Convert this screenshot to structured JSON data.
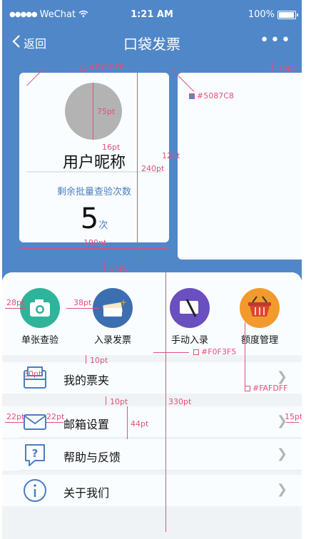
{
  "status": {
    "carrier": "WeChat",
    "time": "1:21 AM",
    "battery": "100%"
  },
  "nav": {
    "back_label": "返回",
    "title": "口袋发票",
    "more": "•••"
  },
  "card": {
    "nickname": "用户昵称",
    "remaining_label": "剩余批量查验次数",
    "remaining_count": "5",
    "unit": "次"
  },
  "quick_actions": [
    {
      "label": "单张查验",
      "icon": "camera-icon",
      "color": "#2FB39A"
    },
    {
      "label": "入录发票",
      "icon": "invoice-entry-icon",
      "color": "#3B6FB0"
    },
    {
      "label": "手动入录",
      "icon": "manual-entry-icon",
      "color": "#6A4FC0"
    },
    {
      "label": "额度管理",
      "icon": "basket-icon",
      "color": "#F29A2E"
    }
  ],
  "menu": [
    {
      "label": "我的票夹",
      "icon": "folder-icon"
    },
    {
      "label": "邮箱设置",
      "icon": "mail-icon"
    },
    {
      "label": "帮助与反馈",
      "icon": "help-icon"
    },
    {
      "label": "关于我们",
      "icon": "info-icon"
    }
  ],
  "annotations": {
    "card_bg": "#FAFDFF",
    "nav_bg": "#5087C8",
    "panel_bg": "#F0F3F5",
    "row_bg": "#FAFDFF",
    "m15": "15pt",
    "m75": "75pt",
    "m16": "16pt",
    "m12": "12pt",
    "m240": "240pt",
    "m190": "190pt",
    "m14": "14pt",
    "m28": "28pt",
    "m38": "38pt",
    "m10a": "10pt",
    "m30": "30pt",
    "m10b": "10pt",
    "m330": "330pt",
    "m22a": "22pt",
    "m22b": "22pt",
    "m44": "44pt",
    "m15b": "15pt"
  },
  "colors": {
    "primary": "#5087C8",
    "accent_text": "#4A7EC2",
    "annotation": "#E0507A"
  }
}
